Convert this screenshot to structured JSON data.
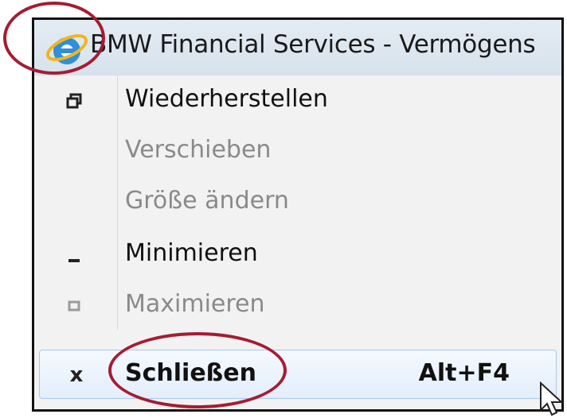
{
  "window": {
    "title": "BMW Financial Services - Vermögens"
  },
  "menu": {
    "items": [
      {
        "label": "Wiederherstellen",
        "enabled": true,
        "icon": "restore-icon"
      },
      {
        "label": "Verschieben",
        "enabled": false,
        "icon": ""
      },
      {
        "label": "Größe ändern",
        "enabled": false,
        "icon": ""
      },
      {
        "label": "Minimieren",
        "enabled": true,
        "icon": "minimize-icon"
      },
      {
        "label": "Maximieren",
        "enabled": false,
        "icon": "maximize-icon"
      }
    ],
    "close": {
      "label": "Schließen",
      "shortcut": "Alt+F4",
      "icon_glyph": "x",
      "icon": "close-icon"
    }
  },
  "colors": {
    "annotation": "#a41d33",
    "highlight_border": "#a8c8e8",
    "disabled_text": "#8a8a8a"
  }
}
